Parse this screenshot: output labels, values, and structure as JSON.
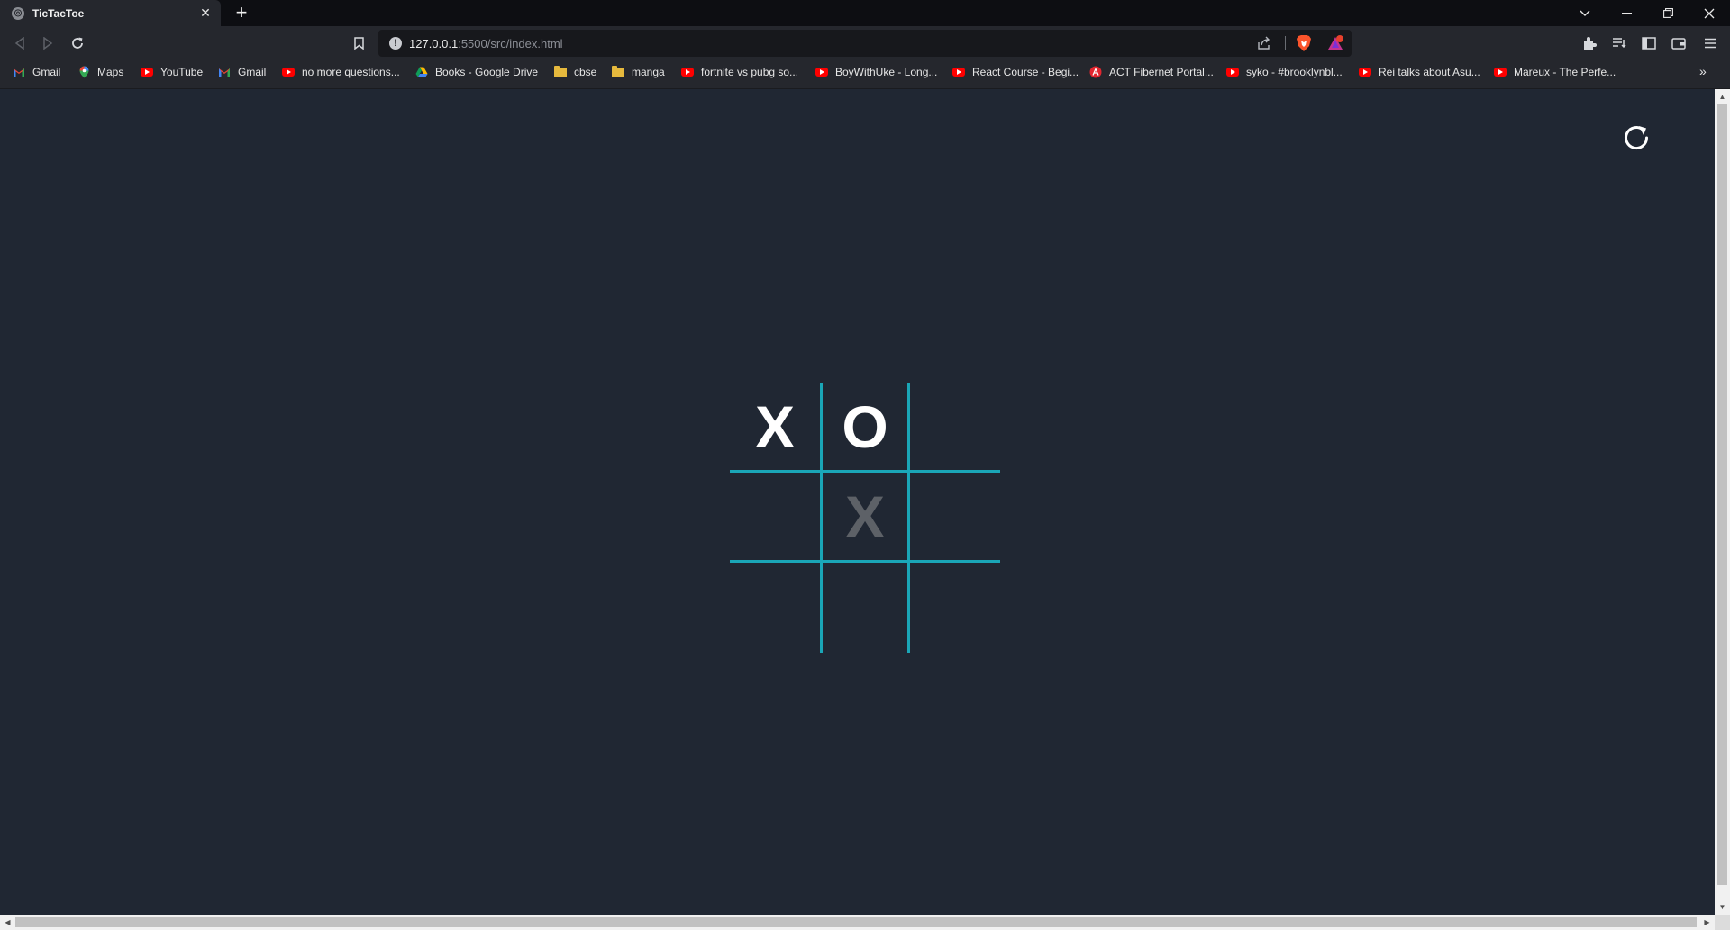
{
  "browser": {
    "tab": {
      "title": "TicTacToe",
      "close_icon": "close-icon"
    },
    "new_tab_icon": "plus-icon",
    "window_controls": [
      "tab-search-icon",
      "minimize-icon",
      "restore-icon",
      "close-icon"
    ],
    "url": {
      "host": "127.0.0.1",
      "rest": ":5500/src/index.html"
    }
  },
  "bookmarks": [
    {
      "label": "Gmail",
      "icon": "gmail-icon"
    },
    {
      "label": "Maps",
      "icon": "maps-icon"
    },
    {
      "label": "YouTube",
      "icon": "youtube-icon"
    },
    {
      "label": "Gmail",
      "icon": "gmail-icon"
    },
    {
      "label": "no more questions...",
      "icon": "youtube-icon"
    },
    {
      "label": "Books - Google Drive",
      "icon": "drive-icon"
    },
    {
      "label": "cbse",
      "icon": "folder-icon"
    },
    {
      "label": "manga",
      "icon": "folder-icon"
    },
    {
      "label": "fortnite vs pubg so...",
      "icon": "youtube-icon"
    },
    {
      "label": "BoyWithUke - Long...",
      "icon": "youtube-icon"
    },
    {
      "label": "React Course - Begi...",
      "icon": "youtube-icon"
    },
    {
      "label": "ACT Fibernet Portal...",
      "icon": "act-icon"
    },
    {
      "label": "syko - #brooklynbl...",
      "icon": "youtube-icon"
    },
    {
      "label": "Rei talks about Asu...",
      "icon": "youtube-icon"
    },
    {
      "label": "Mareux - The Perfe...",
      "icon": "youtube-icon"
    }
  ],
  "game": {
    "restart_icon": "restart-icon",
    "board": [
      "X",
      "O",
      "",
      "",
      "X",
      "",
      "",
      "",
      ""
    ],
    "hover_cell": 4,
    "colors": {
      "background": "#202733",
      "grid_line": "#1aa6b7",
      "mark": "#ffffff",
      "hover_mark": "#5d6167"
    }
  }
}
